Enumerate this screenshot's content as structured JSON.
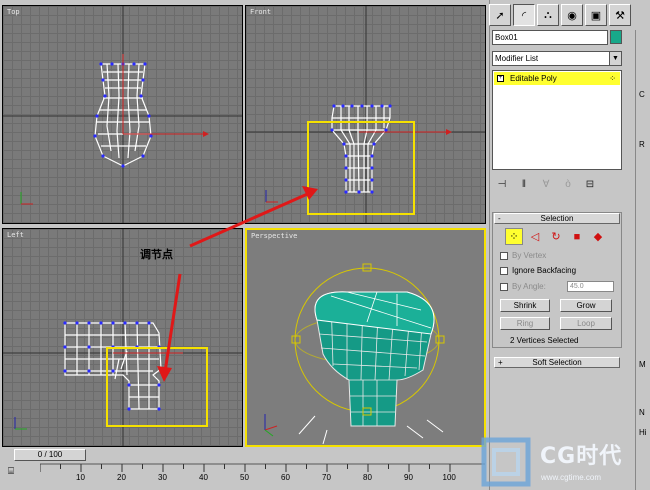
{
  "viewports": {
    "top": "Top",
    "front": "Front",
    "left": "Left",
    "perspective": "Perspective"
  },
  "annotation": "调节点",
  "command_panel": {
    "tabs": [
      "create-icon",
      "modify-icon",
      "hierarchy-icon",
      "motion-icon",
      "display-icon",
      "utilities-icon"
    ],
    "object_name": "Box01",
    "object_color": "#18a88a",
    "modifier_list": "Modifier List",
    "stack_item": "Editable Poly",
    "selection": {
      "title": "Selection",
      "by_vertex": "By Vertex",
      "ignore_backfacing": "Ignore Backfacing",
      "by_angle": "By Angle:",
      "angle_value": "45.0",
      "shrink": "Shrink",
      "grow": "Grow",
      "ring": "Ring",
      "loop": "Loop",
      "status": "2 Vertices Selected"
    },
    "soft_selection": "Soft Selection",
    "side_letters": [
      "C",
      "R",
      "M",
      "N",
      "Hi"
    ]
  },
  "timeline": {
    "frame": "0 / 100",
    "ticks": [
      "10",
      "20",
      "30",
      "40",
      "50",
      "60",
      "70",
      "80",
      "90",
      "100"
    ]
  },
  "watermark": {
    "brand": "CG时代",
    "url": "www.cgtime.com"
  },
  "colors": {
    "selection_box": "#f5e100",
    "arrow": "#e01818",
    "wire_vertex": "#2020ff",
    "mesh": "#159a86"
  }
}
